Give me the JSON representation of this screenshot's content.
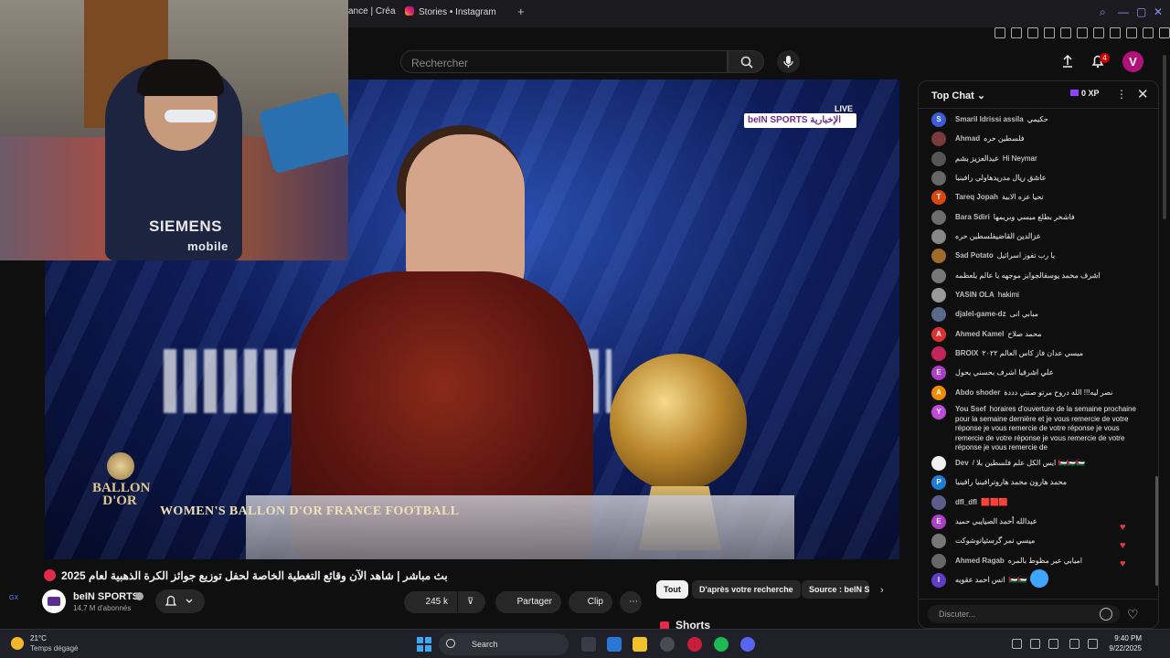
{
  "browser": {
    "tabs": [
      {
        "label": "ance | Créa"
      },
      {
        "label": "Stories • Instagram"
      }
    ],
    "new_tab": "+"
  },
  "header": {
    "search_placeholder": "Rechercher",
    "notifications_count": "4",
    "avatar_letter": "V"
  },
  "webcam": {
    "shirt_text": "SIEMENS",
    "shirt_text_2": "mobile"
  },
  "video": {
    "live_label": "LIVE",
    "channel_logo": "beIN",
    "channel_logo_2": "SPORTS",
    "channel_logo_ar": "الإخبارية",
    "ballon_text": "BALLON D'OR",
    "caption": "WOMEN'S BALLON D'OR FRANCE FOOTBALL"
  },
  "below": {
    "title": "بث مباشر | شاهد الآن وقائع التغطية الخاصة لحفل توزيع جوائز الكرة الذهبية لعام 2025",
    "channel_name": "beIN SPORTS",
    "subscribers": "14,7 M d'abonnés",
    "likes": "245 k",
    "share_label": "Partager",
    "clip_label": "Clip",
    "chips": [
      "Tout",
      "D'après votre recherche",
      "Source : beIN S"
    ],
    "shorts_label": "Shorts"
  },
  "chat": {
    "title": "Top Chat",
    "xp": "0 XP",
    "input_placeholder": "Discuter...",
    "messages": [
      {
        "initial": "S",
        "color": "#3b5bdb",
        "author": "Smaril Idrissi assila",
        "text": "حكيمي"
      },
      {
        "initial": "",
        "color": "#7a3b3b",
        "author": "Ahmad",
        "text": "فلسطين حره"
      },
      {
        "initial": "",
        "color": "#555",
        "author": "عبدالعزيز بشم",
        "text": "Hi Neymar"
      },
      {
        "initial": "",
        "color": "#666",
        "author": "عاشق ريال مدريد",
        "text": "هاولي رافينيا"
      },
      {
        "initial": "T",
        "color": "#d9480f",
        "author": "Tareq Jopah",
        "text": "تحيا عزه الابية"
      },
      {
        "initial": "",
        "color": "#6d6d6d",
        "author": "Bara Sdiri",
        "text": "فاشخر بطلع ميسي وبريمها"
      },
      {
        "initial": "",
        "color": "#888",
        "author": "عزالدين القاضي",
        "text": "فلسطين حره"
      },
      {
        "initial": "",
        "color": "#a06a2a",
        "author": "Sad Potato",
        "text": "يا رب تفوز اسرائيل"
      },
      {
        "initial": "",
        "color": "#777",
        "author": "اشرف محمد يوسف",
        "text": "الجوايز موجهه يا عالم يلعظمه"
      },
      {
        "initial": "",
        "color": "#999",
        "author": "YASIN OLA",
        "text": "hakimi"
      },
      {
        "initial": "",
        "color": "#5a6a8a",
        "author": "djalel-game-dz",
        "text": "مبابي انى"
      },
      {
        "initial": "A",
        "color": "#e03131",
        "author": "Ahmed Kamel",
        "text": "محمد صلاح"
      },
      {
        "initial": "",
        "color": "#c2255c",
        "author": "BROIX",
        "text": "ميسي عدان فاز كاس العالم ٢٠٢٢"
      },
      {
        "initial": "E",
        "color": "#ae3ec9",
        "author": "علي اشرف",
        "text": "يا اشرف بحسني يحول"
      },
      {
        "initial": "A",
        "color": "#f08c00",
        "author": "Abdo shoder",
        "text": "نصر ليه!!! الله دروح مرتو صنتي دددة"
      },
      {
        "initial": "Y",
        "color": "#be4bdb",
        "author": "You Ssef",
        "text": "horaires d'ouverture de la semaine prochaine pour la semaine dernière et je vous remercie de votre réponse je vous remercie de votre réponse je vous remercie de votre réponse je vous remercie de votre réponse je vous remercie de",
        "tall": true
      },
      {
        "initial": "",
        "color": "#f1f1f1",
        "author": "Dev",
        "text": "/ ايس الكل علم فلسطين بلا 🇵🇸🇵🇸🇵🇸"
      },
      {
        "initial": "P",
        "color": "#1c7ed6",
        "author": "محمد هارون محمد هارون",
        "text": "رافينيا رافينيا"
      },
      {
        "initial": "",
        "color": "#5c5c8a",
        "author": "dfl_dfl",
        "text": "🟥🟥🟥"
      },
      {
        "initial": "E",
        "color": "#ae3ec9",
        "author": "عبدالله أحمد الصياي",
        "text": "بي حميد"
      },
      {
        "initial": "",
        "color": "#777",
        "author": "ميسي نمر گرستيانو",
        "text": "شوكت"
      },
      {
        "initial": "",
        "color": "#666",
        "author": "Ahmed Ragab",
        "text": "اميابي عير مظوط بالمره"
      },
      {
        "initial": "I",
        "color": "#5f3dc4",
        "author": "انس احمد عقوبه",
        "text": "🇵🇸🇵🇸"
      }
    ]
  },
  "taskbar": {
    "temperature": "21°C",
    "condition": "Temps dégagé",
    "search_label": "Search",
    "time": "9:40 PM",
    "date": "9/22/2025"
  }
}
